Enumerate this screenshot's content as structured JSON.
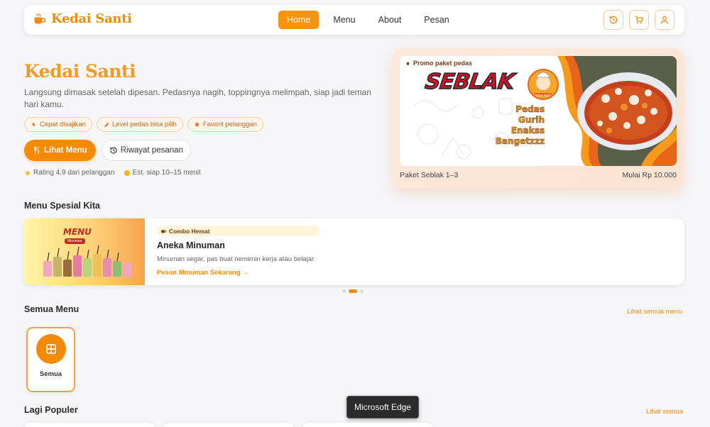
{
  "nav": {
    "brand": "Kedai Santi",
    "links": [
      "Home",
      "Menu",
      "About",
      "Pesan"
    ],
    "active_link": "Home",
    "actions": [
      "history-icon",
      "cart-icon",
      "user-icon"
    ]
  },
  "hero": {
    "title": "Kedai Santi",
    "description": "Langsung dimasak setelah dipesan. Pedasnya nagih, toppingnya melimpah, siap jadi teman hari kamu.",
    "chips": [
      {
        "icon": "bolt-icon",
        "label": "Cepat disajikan"
      },
      {
        "icon": "chili-icon",
        "label": "Level pedas bisa pilih"
      },
      {
        "icon": "star-icon",
        "label": "Favorit pelanggan"
      }
    ],
    "primary_button": "Lihat Menu",
    "secondary_button": "Riwayat pesanan",
    "rating": "Rating 4.9 dari pelanggan",
    "estimate": "Est. siap 10–15 menit"
  },
  "promo": {
    "tag": "Promo paket pedas",
    "banner_title": "SEBLAK",
    "banner_lines": [
      "Pedas",
      "Gurih",
      "Enakss",
      "Bangetzzz"
    ],
    "mascot_label": "KEDAI SANTI",
    "caption_left": "Paket Seblak 1–3",
    "caption_right": "Mulai Rp 10.000"
  },
  "special": {
    "section_title": "Menu Spesial Kita",
    "image_label": "MENU",
    "image_sublabel": "Minuman",
    "badge": "Combo Hemat",
    "title": "Aneka Minuman",
    "description": "Minuman segar, pas buat nemenin kerja atau belajar.",
    "link": "Pesan Minuman Sekarang →",
    "slide_count": 3,
    "active_slide": 2
  },
  "all_menu": {
    "section_title": "Semua Menu",
    "see_all": "Lihat semua menu",
    "categories": [
      {
        "icon": "grid-icon",
        "label": "Semua"
      }
    ]
  },
  "popular": {
    "section_title": "Lagi Populer",
    "see_all": "Lihat semua"
  },
  "tooltip": "Microsoft Edge",
  "colors": {
    "accent": "#f58a07",
    "brand": "#f08c0a",
    "background": "#f6f6f8"
  }
}
